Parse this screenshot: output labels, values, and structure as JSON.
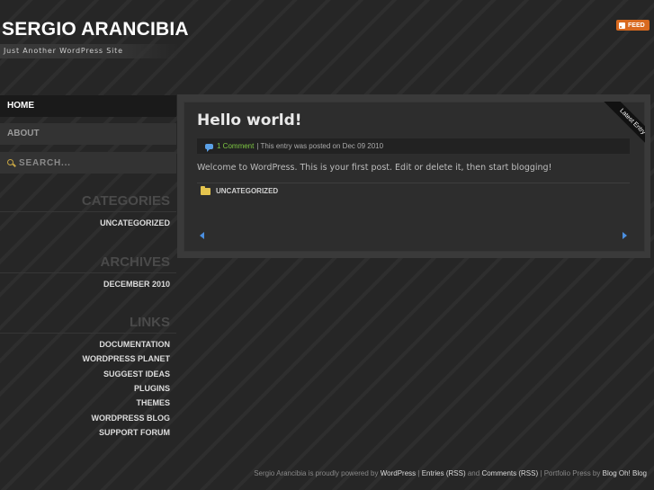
{
  "header": {
    "site_title": "SERGIO ARANCIBIA",
    "tagline": "Just Another WordPress Site",
    "feed_label": "FEED",
    "feed_icon": "rss-icon"
  },
  "nav": {
    "home": "HOME",
    "about": "ABOUT",
    "search_placeholder": "SEARCH..."
  },
  "sidebar": {
    "categories": {
      "heading": "CATEGORIES",
      "items": [
        "UNCATEGORIZED"
      ]
    },
    "archives": {
      "heading": "ARCHIVES",
      "items": [
        "DECEMBER 2010"
      ]
    },
    "links": {
      "heading": "LINKS",
      "items": [
        "DOCUMENTATION",
        "WORDPRESS PLANET",
        "SUGGEST IDEAS",
        "PLUGINS",
        "THEMES",
        "WORDPRESS BLOG",
        "SUPPORT FORUM"
      ]
    }
  },
  "post": {
    "ribbon": "Latest Entry",
    "title": "Hello world!",
    "comments_link": "1 Comment",
    "meta_text": "| This entry was posted on Dec 09 2010",
    "content": "Welcome to WordPress. This is your first post. Edit or delete it, then start blogging!",
    "category": "UNCATEGORIZED"
  },
  "footer": {
    "prefix": "Sergio Arancibia is proudly powered by",
    "wordpress": "WordPress",
    "sep1": "|",
    "entries_rss": "Entries (RSS)",
    "and": "and",
    "comments_rss": "Comments (RSS)",
    "sep2": "|",
    "portfolio": "Portfolio Press by",
    "ohblog": "Blog Oh! Blog"
  }
}
